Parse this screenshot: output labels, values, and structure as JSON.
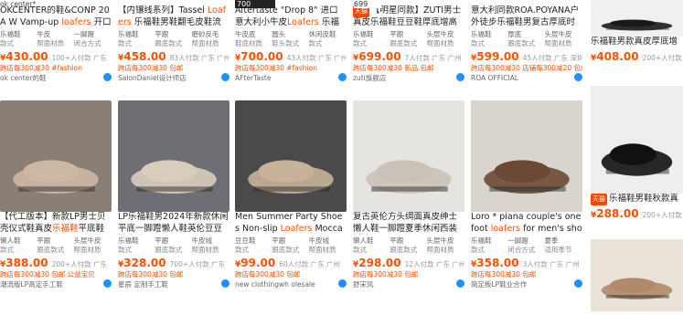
{
  "row1": [
    {
      "title_pre": "OKCENTER的鞋&CONP 20A W Vamp-up ",
      "title_hl": "loafers",
      "title_post": " 开口乐...",
      "attrs": [
        [
          "乐福鞋",
          "款式"
        ],
        [
          "牛皮",
          "帮面材质"
        ],
        [
          "一脚蹬",
          "闭合方式"
        ]
      ],
      "price": "430.00",
      "sales": "100+人付款 广东",
      "promo": "跨店每300减30 #fashion",
      "shop": "ok center的鞋"
    },
    {
      "title_pre": "【内镶线系列】Tassel ",
      "title_hl": "Loafers",
      "title_post": " 乐福鞋男鞋翻毛皮鞋流苏休闲...",
      "attrs": [
        [
          "乐福鞋",
          "款式"
        ],
        [
          "平跟",
          "跟底款式"
        ],
        [
          "磨砂反毛",
          "帮面材质"
        ]
      ],
      "price": "458.00",
      "sales": "83人付款 广东 广州",
      "promo": "跨店每300减30 包邮",
      "shop": "SalonDaniel设计师店"
    },
    {
      "title_pre": "Aftertaste \"Drop 8\" 进口意大利小牛皮",
      "title_hl": "Loafers",
      "title_post": " 乐福鞋",
      "attrs": [
        [
          "牛皮底",
          "鞋底材质"
        ],
        [
          "圆头",
          "鞋头款式"
        ],
        [
          "休闲皮鞋",
          "款式"
        ]
      ],
      "price": "700.00",
      "sales": "43人付款 广东 广州",
      "promo": "跨店每300减30 #fashion",
      "shop": "AFterTaste"
    },
    {
      "badge": "天猫",
      "title_pre": "【明星同款】ZUTI男士真皮乐福鞋豆豆鞋厚底增高休闲...",
      "title_hl": "",
      "title_post": "",
      "attrs": [
        [
          "乐福鞋",
          "款式"
        ],
        [
          "平跟",
          "跟底款式"
        ],
        [
          "头层牛皮",
          "帮面材质"
        ]
      ],
      "price": "699.00",
      "sales": "7人付款 广东 广州",
      "promo": "跨店每300减30 新品 包邮",
      "shop": "zuti旗舰店"
    },
    {
      "title_pre": "意大利同款ROA.POYANA户外徒步乐福鞋男复古厚底时尚增高...",
      "title_hl": "",
      "title_post": "",
      "attrs": [
        [
          "乐福鞋",
          "款式"
        ],
        [
          "厚底",
          "跟底款式"
        ],
        [
          "头层牛皮",
          "帮面材质"
        ]
      ],
      "price": "599.00",
      "sales": "45人付款 广东 深圳",
      "promo": "跨店每300减30 店铺每300减20 包邮",
      "shop": "ROA OFFICIAL"
    }
  ],
  "row2": [
    {
      "title_pre": "【代工版本】新款LP男士贝壳仪式鞋真皮",
      "title_hl": "乐福鞋",
      "title_post": "平底鞋一脚蹬...",
      "attrs": [
        [
          "懒人鞋",
          "款式"
        ],
        [
          "平跟",
          "跟底款式"
        ],
        [
          "头层牛皮",
          "帮面材质"
        ]
      ],
      "price": "388.00",
      "sales": "200+人付款 广东",
      "promo": "跨店每300减30 包邮 公益宝贝",
      "shop": "潮流版LP高定手工鞋"
    },
    {
      "title_pre": "LP乐福鞋男2024年新款休闲平底一脚蹬懒人鞋英伦豆豆鞋牛皮...",
      "title_hl": "",
      "title_post": "",
      "attrs": [
        [
          "乐福鞋",
          "款式"
        ],
        [
          "平跟",
          "跟底款式"
        ],
        [
          "牛皮绒",
          "帮面材质"
        ]
      ],
      "price": "328.00",
      "sales": "700+人付款 广东",
      "promo": "跨店每300减30 包邮",
      "shop": "星辰 定制手工鞋"
    },
    {
      "title_pre": "Men Summer Party Shoes Non-slip ",
      "title_hl": "Loafers",
      "title_post": " Moccasins ...",
      "attrs": [
        [
          "豆豆鞋",
          "款式"
        ],
        [
          "平跟",
          "跟底款式"
        ],
        [
          "牛皮绒",
          "帮面材质"
        ]
      ],
      "price": "99.00",
      "sales": "60人付款 广东 广州",
      "promo": "跨店每300减30 包邮",
      "shop": "new clothingwh olesale"
    },
    {
      "title_pre": "复古英伦方头绸面真皮绅士懒人鞋一脚蹬夏季休闲西装婚礼...",
      "title_hl": "",
      "title_post": "",
      "attrs": [
        [
          "懒人鞋",
          "款式"
        ],
        [
          "平跟",
          "跟底款式"
        ],
        [
          "头层牛皮",
          "帮面材质"
        ]
      ],
      "price": "298.00",
      "sales": "12人付款 广东 广州",
      "promo": "跨店每300减30 包邮",
      "shop": "舒宋风"
    },
    {
      "title_pre": "Loro * piana couple's one foot ",
      "title_hl": "loafers",
      "title_post": " for men's shoes",
      "attrs": [
        [
          "乐福鞋",
          "款式"
        ],
        [
          "一脚蹬",
          "闭合方式"
        ],
        [
          "夏季",
          "适用季节"
        ]
      ],
      "price": "358.00",
      "sales": "3人付款 广东 广州",
      "promo": "跨店每300减30 包邮",
      "shop": "简定板LP鞋业合作"
    }
  ],
  "col6": [
    {
      "title": "乐福鞋男款真皮厚底增高",
      "price": "408.00",
      "sales": "200+人付款"
    },
    {
      "badge": "天猫",
      "title": "乐福鞋男鞋秋款真皮",
      "price": "288.00",
      "sales": "200+人付款 广东"
    }
  ],
  "topbar": {
    "logo": "ok center*",
    "price_fragment": "700",
    "price_fragment2": "699"
  },
  "colors": {
    "accent": "#ff5000",
    "tmall": "#ff4400",
    "ww": "#1e90ff"
  }
}
